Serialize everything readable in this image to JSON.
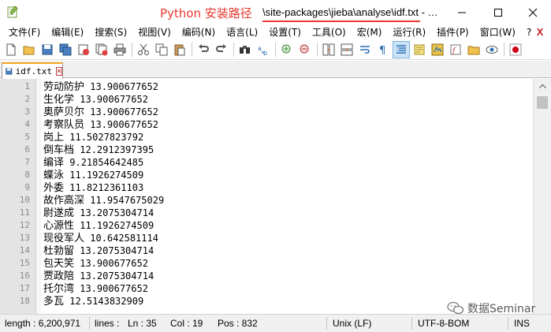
{
  "window": {
    "title_annotation": "Python 安装路径",
    "title": "\\site-packages\\jieba\\analyse\\idf.txt - …"
  },
  "menu": [
    "文件(F)",
    "编辑(E)",
    "搜索(S)",
    "视图(V)",
    "编码(N)",
    "语言(L)",
    "设置(T)",
    "工具(O)",
    "宏(M)",
    "运行(R)",
    "插件(P)",
    "窗口(W)",
    "?"
  ],
  "menu_close": "X",
  "toolbar_icons": [
    "new-file-icon",
    "open-file-icon",
    "save-icon",
    "save-all-icon",
    "close-icon",
    "close-all-icon",
    "print-icon",
    "cut-icon",
    "copy-icon",
    "paste-icon",
    "undo-icon",
    "redo-icon",
    "find-icon",
    "replace-icon",
    "zoom-in-icon",
    "zoom-out-icon",
    "sync-v-icon",
    "sync-h-icon",
    "word-wrap-icon",
    "show-all-chars-icon",
    "indent-guide-icon",
    "doc-map-icon",
    "function-list-icon",
    "folder-workspace-icon",
    "monitor-icon",
    "record-macro-icon"
  ],
  "tab": {
    "label": "idf.txt"
  },
  "lines": [
    {
      "n": "1",
      "word": "劳动防护",
      "value": "13.900677652"
    },
    {
      "n": "2",
      "word": "生化学",
      "value": "13.900677652"
    },
    {
      "n": "3",
      "word": "奥萨贝尔",
      "value": "13.900677652"
    },
    {
      "n": "4",
      "word": "考察队员",
      "value": "13.900677652"
    },
    {
      "n": "5",
      "word": "岗上",
      "value": "11.5027823792"
    },
    {
      "n": "6",
      "word": "倒车档",
      "value": "12.2912397395"
    },
    {
      "n": "7",
      "word": "编译",
      "value": "9.21854642485"
    },
    {
      "n": "8",
      "word": "蝶泳",
      "value": "11.1926274509"
    },
    {
      "n": "9",
      "word": "外委",
      "value": "11.8212361103"
    },
    {
      "n": "10",
      "word": "故作高深",
      "value": "11.9547675029"
    },
    {
      "n": "11",
      "word": "尉遂成",
      "value": "13.2075304714"
    },
    {
      "n": "12",
      "word": "心源性",
      "value": "11.1926274509"
    },
    {
      "n": "13",
      "word": "现役军人",
      "value": "10.642581114"
    },
    {
      "n": "14",
      "word": "杜勃留",
      "value": "13.2075304714"
    },
    {
      "n": "15",
      "word": "包天笑",
      "value": "13.900677652"
    },
    {
      "n": "16",
      "word": "贾政陪",
      "value": "13.2075304714"
    },
    {
      "n": "17",
      "word": "托尔湾",
      "value": "13.900677652"
    },
    {
      "n": "18",
      "word": "多瓦",
      "value": "12.5143832909"
    }
  ],
  "watermark": "数据Seminar",
  "status": {
    "length": "length : 6,200,971",
    "lines": "lines :",
    "ln": "Ln : 35",
    "col": "Col : 19",
    "pos": "Pos : 832",
    "eol": "Unix (LF)",
    "encoding": "UTF-8-BOM",
    "mode": "INS"
  },
  "colors": {
    "annotation": "#e8372f",
    "tab_accent": "#f5a623"
  }
}
